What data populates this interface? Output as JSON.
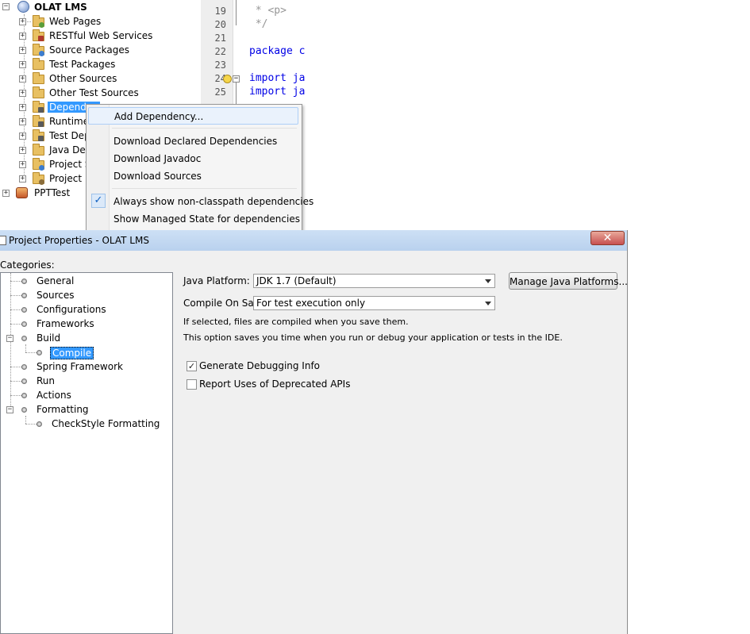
{
  "tree": {
    "root": "OLAT LMS",
    "items": [
      {
        "label": "Web Pages"
      },
      {
        "label": "RESTful Web Services"
      },
      {
        "label": "Source Packages"
      },
      {
        "label": "Test Packages"
      },
      {
        "label": "Other Sources"
      },
      {
        "label": "Other Test Sources"
      },
      {
        "label": "Dependen"
      },
      {
        "label": "Runtime D"
      },
      {
        "label": "Test Depe"
      },
      {
        "label": "Java Dep"
      },
      {
        "label": "Project Si"
      },
      {
        "label": "Project Fi"
      }
    ],
    "second_root": "PPTTest"
  },
  "editor": {
    "line_numbers": [
      "19",
      "20",
      "21",
      "22",
      "23",
      "24",
      "25"
    ],
    "lines": [
      {
        "text": " * <p>"
      },
      {
        "text": " */"
      },
      {
        "text": ""
      },
      {
        "text": "package c"
      },
      {
        "text": ""
      },
      {
        "text": "import ja"
      },
      {
        "text": "import ja"
      }
    ]
  },
  "context_menu": {
    "items": [
      {
        "label": "Add Dependency..."
      },
      {
        "label": "Download Declared Dependencies"
      },
      {
        "label": "Download Javadoc"
      },
      {
        "label": "Download Sources"
      },
      {
        "label": "Always show non-classpath dependencies",
        "checked": true
      },
      {
        "label": "Show Managed State for dependencies"
      }
    ]
  },
  "dialog": {
    "title": "Project Properties - OLAT LMS",
    "close_glyph": "✕",
    "categories_label": "Categories:",
    "categories": [
      {
        "label": "General"
      },
      {
        "label": "Sources"
      },
      {
        "label": "Configurations"
      },
      {
        "label": "Frameworks"
      },
      {
        "label": "Build"
      },
      {
        "label": "Compile",
        "selected": true
      },
      {
        "label": "Spring Framework"
      },
      {
        "label": "Run"
      },
      {
        "label": "Actions"
      },
      {
        "label": "Formatting"
      },
      {
        "label": "CheckStyle Formatting"
      }
    ],
    "java_platform_label": "Java Platform:",
    "java_platform_value": "JDK 1.7 (Default)",
    "manage_button": "Manage Java Platforms...",
    "compile_on_save_label": "Compile On Save:",
    "compile_on_save_value": "For test execution only",
    "info_line1": "If selected, files are compiled when you save them.",
    "info_line2": "This option saves you time when you run or debug your application or tests in the IDE.",
    "debug_info_label": "Generate Debugging Info",
    "debug_info_checked": true,
    "deprecated_label": "Report Uses of Deprecated APIs",
    "deprecated_checked": false
  }
}
